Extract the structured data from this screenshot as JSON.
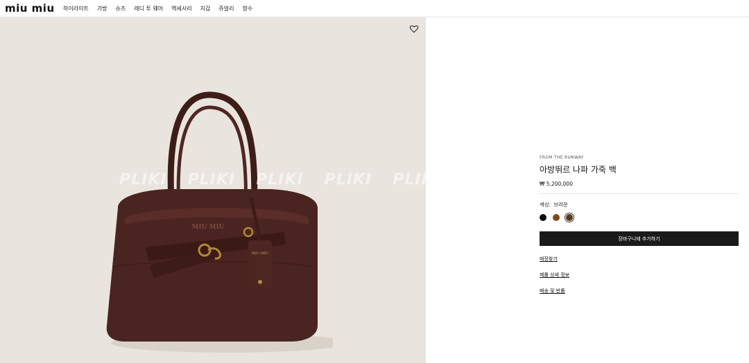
{
  "header": {
    "logo": "miu miu",
    "nav": [
      "하이라이트",
      "가방",
      "슈즈",
      "레디 투 웨어",
      "액세서리",
      "지갑",
      "쥬얼리",
      "향수"
    ]
  },
  "gallery": {
    "watermark": [
      "PLIKI",
      "PLIKI",
      "PLIKI",
      "PLIKI",
      "PLIKI"
    ],
    "wishlist_icon": "heart-outline-icon"
  },
  "product": {
    "eyebrow": "FROM THE RUNWAY",
    "title": "아방뛰르 나파 가죽 백",
    "price": "₩ 5,200,000",
    "color_label": "색상:",
    "color_value": "브라운",
    "swatches": [
      {
        "name": "black",
        "color": "#0d0d0d"
      },
      {
        "name": "tan",
        "color": "#7b4a1c"
      },
      {
        "name": "brown",
        "color": "#5a3a1c",
        "selected": true
      }
    ],
    "cart_button": "장바구니에 추가하기",
    "links": [
      "매장찾기",
      "제품 상세 정보",
      "배송 및 반품"
    ]
  },
  "colors": {
    "gallery_bg": "#e9e5de",
    "bag_leather": "#4a2420",
    "button_bg": "#1a1a1a"
  }
}
